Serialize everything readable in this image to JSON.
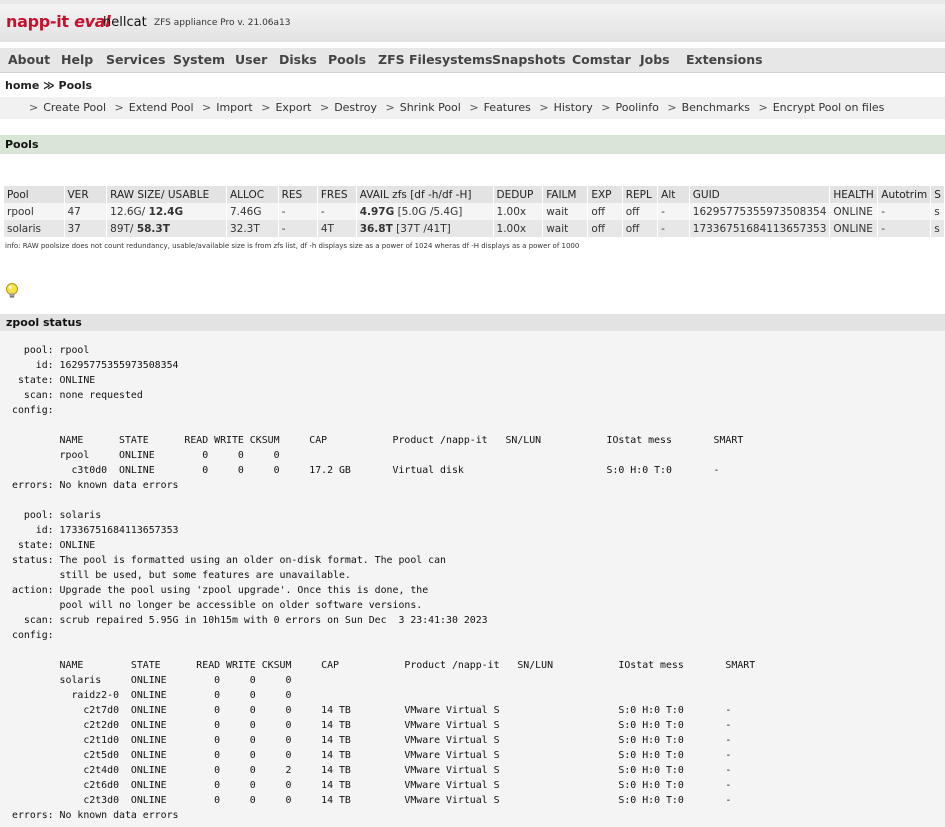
{
  "header": {
    "logo_main": "napp-it",
    "logo_eval": "eval",
    "host": "hellcat",
    "version": "ZFS appliance Pro v. 21.06a13"
  },
  "menu": [
    "About",
    "Help",
    "Services",
    "System",
    "User",
    "Disks",
    "Pools",
    "ZFS Filesystems",
    "Snapshots",
    "Comstar",
    "Jobs",
    "Extensions"
  ],
  "breadcrumb": {
    "home": "home",
    "sep": "≫",
    "current": "Pools"
  },
  "subnav": [
    "Create Pool",
    "Extend Pool",
    "Import",
    "Export",
    "Destroy",
    "Shrink Pool",
    "Features",
    "History",
    "Poolinfo",
    "Benchmarks",
    "Encrypt Pool on files"
  ],
  "section_title": "Pools",
  "pools_table": {
    "headers": [
      "Pool",
      "VER",
      "RAW SIZE/ USABLE",
      "ALLOC",
      "RES",
      "FRES",
      "AVAIL zfs [df -h/df -H]",
      "DEDUP",
      "FAILM",
      "EXP",
      "REPL",
      "Alt",
      "GUID",
      "HEALTH",
      "Autotrim",
      "S"
    ],
    "rows": [
      {
        "pool": "rpool",
        "ver": "47",
        "raw": "12.6G/",
        "usable": "12.4G",
        "alloc": "7.46G",
        "res": "-",
        "fres": "-",
        "avail": "4.97G",
        "avail_df": "[5.0G /5.4G]",
        "dedup": "1.00x",
        "failm": "wait",
        "exp": "off",
        "repl": "off",
        "alt": "-",
        "guid": "16295775355973508354",
        "health": "ONLINE",
        "autotrim": "-",
        "s": "s"
      },
      {
        "pool": "solaris",
        "ver": "37",
        "raw": "89T/",
        "usable": "58.3T",
        "alloc": "32.3T",
        "res": "-",
        "fres": "4T",
        "avail": "36.8T",
        "avail_df": "[37T /41T]",
        "dedup": "1.00x",
        "failm": "wait",
        "exp": "off",
        "repl": "off",
        "alt": "-",
        "guid": "17336751684113657353",
        "health": "ONLINE",
        "autotrim": "-",
        "s": "s"
      }
    ]
  },
  "info": "info: RAW poolsize does not count redundancy, usable/available size is from zfs list, df -h displays size as a power of 1024 wheras df -H displays as a power of 1000",
  "zpool_status_title": "zpool status",
  "zpool_status_text": "  pool: rpool\n    id: 16295775355973508354\n state: ONLINE\n  scan: none requested\nconfig:\n\n        NAME      STATE      READ WRITE CKSUM     CAP           Product /napp-it   SN/LUN           IOstat mess       SMART\n        rpool     ONLINE        0     0     0\n          c3t0d0  ONLINE        0     0     0     17.2 GB       Virtual disk                        S:0 H:0 T:0       -\nerrors: No known data errors\n\n  pool: solaris\n    id: 17336751684113657353\n state: ONLINE\nstatus: The pool is formatted using an older on-disk format. The pool can\n        still be used, but some features are unavailable.\naction: Upgrade the pool using 'zpool upgrade'. Once this is done, the\n        pool will no longer be accessible on older software versions.\n  scan: scrub repaired 5.95G in 10h15m with 0 errors on Sun Dec  3 23:41:30 2023\nconfig:\n\n        NAME        STATE      READ WRITE CKSUM     CAP           Product /napp-it   SN/LUN           IOstat mess       SMART\n        solaris     ONLINE        0     0     0\n          raidz2-0  ONLINE        0     0     0\n            c2t7d0  ONLINE        0     0     0     14 TB         VMware Virtual S                    S:0 H:0 T:0       -\n            c2t2d0  ONLINE        0     0     0     14 TB         VMware Virtual S                    S:0 H:0 T:0       -\n            c2t1d0  ONLINE        0     0     0     14 TB         VMware Virtual S                    S:0 H:0 T:0       -\n            c2t5d0  ONLINE        0     0     0     14 TB         VMware Virtual S                    S:0 H:0 T:0       -\n            c2t4d0  ONLINE        0     0     2     14 TB         VMware Virtual S                    S:0 H:0 T:0       -\n            c2t6d0  ONLINE        0     0     0     14 TB         VMware Virtual S                    S:0 H:0 T:0       -\n            c2t3d0  ONLINE        0     0     0     14 TB         VMware Virtual S                    S:0 H:0 T:0       -\nerrors: No known data errors",
  "icons": {
    "hint": "lightbulb-icon"
  },
  "colors": {
    "logo_red": "#c8102e",
    "section_green": "#d9e5d6"
  }
}
